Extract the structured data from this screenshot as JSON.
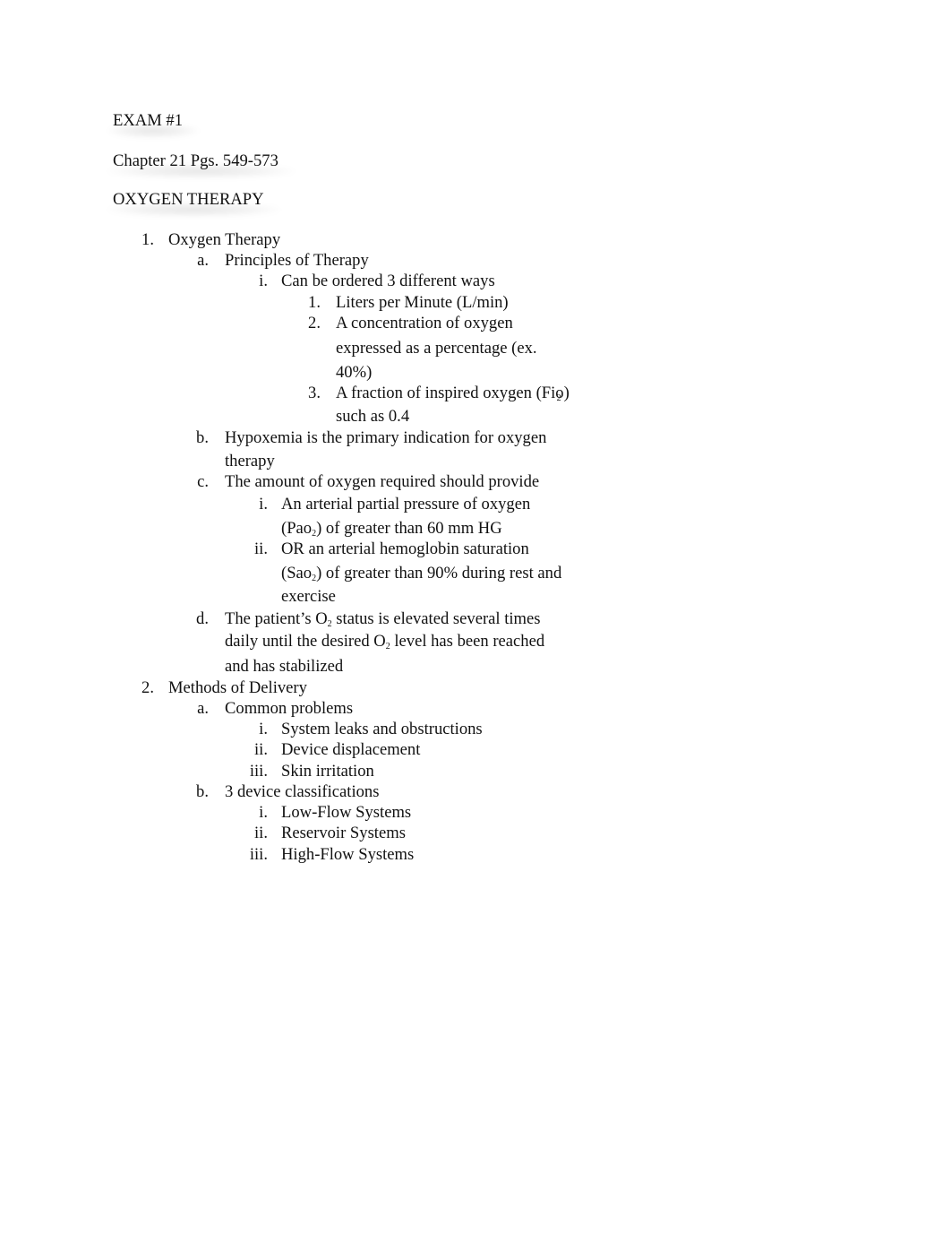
{
  "document": {
    "headings": {
      "exam": "EXAM #1",
      "chapter": "Chapter 21 Pgs. 549-573",
      "topic": "OXYGEN THERAPY"
    },
    "outline": [
      {
        "marker": "1.",
        "text": "Oxygen Therapy",
        "children": [
          {
            "marker": "a.",
            "text": "Principles of Therapy",
            "children": [
              {
                "marker": "i.",
                "text": "Can be ordered 3 different ways",
                "children": [
                  {
                    "marker": "1.",
                    "text": "Liters per Minute (L/min)"
                  },
                  {
                    "marker": "2.",
                    "lines": [
                      "A concentration of oxygen",
                      "expressed as a percentage (ex.",
                      "40%)"
                    ]
                  },
                  {
                    "marker": "3.",
                    "lines_pre": "A fraction of inspired oxygen (Fio",
                    "sub": "2",
                    "lines_post": ")",
                    "line2": "such as 0.4"
                  }
                ]
              }
            ]
          },
          {
            "marker": "b.",
            "lines": [
              "Hypoxemia is the primary indication for oxygen",
              "therapy"
            ]
          },
          {
            "marker": "c.",
            "text": "The amount of oxygen required should provide",
            "children": [
              {
                "marker": "i.",
                "line1": "An arterial partial pressure of oxygen",
                "line2_pre": "(Pao",
                "sub": "2",
                "line2_post": ") of greater than 60 mm HG"
              },
              {
                "marker": "ii.",
                "line1": "OR an arterial hemoglobin saturation",
                "line2_pre": "(Sao",
                "sub": "2",
                "line2_post": ") of greater than 90% during rest and",
                "line3": "exercise"
              }
            ]
          },
          {
            "marker": "d.",
            "line1_pre": "The patient’s O",
            "line1_sub": "2",
            "line1_post": " status is elevated several times",
            "line2_pre": "daily until the desired O",
            "line2_sub": "2",
            "line2_post": " level has been reached",
            "line3": "and has stabilized"
          }
        ]
      },
      {
        "marker": "2.",
        "text": "Methods of Delivery",
        "children": [
          {
            "marker": "a.",
            "text": "Common problems",
            "children": [
              {
                "marker": "i.",
                "text": "System leaks and obstructions"
              },
              {
                "marker": "ii.",
                "text": "Device displacement"
              },
              {
                "marker": "iii.",
                "text": "Skin irritation"
              }
            ]
          },
          {
            "marker": "b.",
            "text": "3 device classifications",
            "children": [
              {
                "marker": "i.",
                "text": "Low-Flow Systems"
              },
              {
                "marker": "ii.",
                "text": "Reservoir Systems"
              },
              {
                "marker": "iii.",
                "text": "High-Flow Systems"
              }
            ]
          }
        ]
      }
    ]
  }
}
